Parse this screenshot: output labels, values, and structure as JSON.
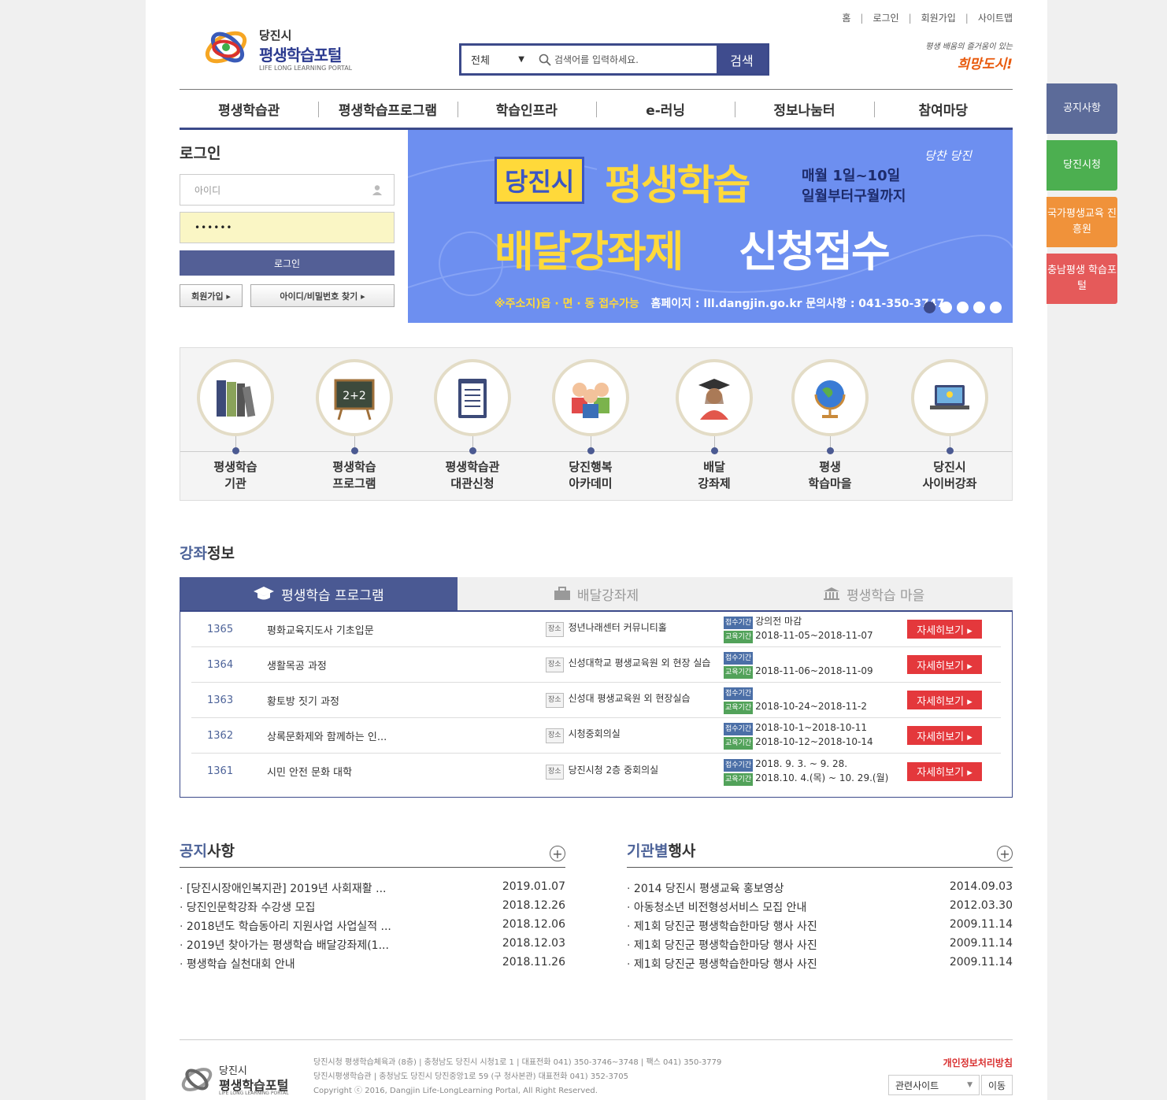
{
  "toplinks": [
    "홈",
    "로그인",
    "회원가입",
    "사이트맵"
  ],
  "logo": {
    "line1": "당진시",
    "line2": "평생학습포털",
    "line3": "LIFE LONG LEARNING PORTAL"
  },
  "search": {
    "select_value": "전체",
    "placeholder": "검색어를 입력하세요.",
    "button": "검색"
  },
  "slogan": {
    "line1": "평생 배움의 즐거움이 있는",
    "line2": "희망도시!"
  },
  "gnb": [
    "평생학습관",
    "평생학습프로그램",
    "학습인프라",
    "e-러닝",
    "정보나눔터",
    "참여마당"
  ],
  "login": {
    "title": "로그인",
    "id_placeholder": "아이디",
    "pw_value": "••••••",
    "login_button": "로그인",
    "join_button": "회원가입 ▸",
    "find_button": "아이디/비밀번호 찾기 ▸"
  },
  "banner": {
    "city": "당진시",
    "title": "평생학습",
    "date1": "매월 1일~10일",
    "date2": "일월부터구월까지",
    "sub1": "배달강좌제",
    "sub2": "신청접수",
    "tag": "당찬 당진",
    "info_a": "※주소지)읍 · 면 · 동 접수가능",
    "info_b": "홈페이지 : lll.dangjin.go.kr   문의사항 : 041-350-3747"
  },
  "quick": [
    {
      "icon": "books-icon",
      "line1": "평생학습",
      "line2": "기관"
    },
    {
      "icon": "blackboard-icon",
      "line1": "평생학습",
      "line2": "프로그램"
    },
    {
      "icon": "clipboard-icon",
      "line1": "평생학습관",
      "line2": "대관신청"
    },
    {
      "icon": "people-icon",
      "line1": "당진행복",
      "line2": "아카데미"
    },
    {
      "icon": "graduate-icon",
      "line1": "배달",
      "line2": "강좌제"
    },
    {
      "icon": "globe-icon",
      "line1": "평생",
      "line2": "학습마을"
    },
    {
      "icon": "laptop-icon",
      "line1": "당진시",
      "line2": "사이버강좌"
    }
  ],
  "courses": {
    "title_a": "강좌",
    "title_b": "정보",
    "tabs": [
      "평생학습 프로그램",
      "배달강좌제",
      "평생학습 마을"
    ],
    "place_tag": "장소",
    "apply_tag": "접수기간",
    "edu_tag": "교육기간",
    "more": "자세히보기 ▸",
    "rows": [
      {
        "no": "1365",
        "title": "평화교육지도사 기초입문",
        "place": "정년나래센터 커뮤니티홀",
        "apply": "강의전 마감",
        "edu": "2018-11-05~2018-11-07"
      },
      {
        "no": "1364",
        "title": "생활목공 과정",
        "place": "신성대학교 평생교육원 외 현장 실습",
        "apply": "",
        "edu": "2018-11-06~2018-11-09"
      },
      {
        "no": "1363",
        "title": "황토방 짓기 과정",
        "place": "신성대 평생교육원 외 현장실습",
        "apply": "",
        "edu": "2018-10-24~2018-11-2"
      },
      {
        "no": "1362",
        "title": "상록문화제와 함께하는 인...",
        "place": "시청중회의실",
        "apply": "2018-10-1~2018-10-11",
        "edu": "2018-10-12~2018-10-14"
      },
      {
        "no": "1361",
        "title": "시민 안전 문화 대학",
        "place": "당진시청 2층 중회의실",
        "apply": "2018. 9. 3. ~ 9. 28.",
        "edu": "2018.10. 4.(목) ~ 10. 29.(월)"
      }
    ]
  },
  "notice": {
    "title_a": "공지",
    "title_b": "사항",
    "items": [
      {
        "text": "[당진시장애인복지관] 2019년 사회재활 ...",
        "date": "2019.01.07"
      },
      {
        "text": "당진인문학강좌 수강생 모집",
        "date": "2018.12.26"
      },
      {
        "text": "2018년도 학습동아리 지원사업 사업실적 ...",
        "date": "2018.12.06"
      },
      {
        "text": "2019년 찾아가는 평생학습 배달강좌제(1...",
        "date": "2018.12.03"
      },
      {
        "text": "평생학습 실천대회 안내",
        "date": "2018.11.26"
      }
    ]
  },
  "events": {
    "title_a": "기관별",
    "title_b": "행사",
    "items": [
      {
        "text": "2014 당진시 평생교육 홍보영상",
        "date": "2014.09.03"
      },
      {
        "text": "아동청소년 비전형성서비스 모집 안내",
        "date": "2012.03.30"
      },
      {
        "text": "제1회 당진군 평생학습한마당 행사 사진",
        "date": "2009.11.14"
      },
      {
        "text": "제1회 당진군 평생학습한마당 행사 사진",
        "date": "2009.11.14"
      },
      {
        "text": "제1회 당진군 평생학습한마당 행사 사진",
        "date": "2009.11.14"
      }
    ]
  },
  "footer": {
    "logo1": "당진시",
    "logo2": "평생학습포털",
    "logo3": "LIFE LONG LEARNING PORTAL",
    "addr1": "당진시청 평생학습체육과 (8층) | 충청남도 당진시 시청1로 1 | 대표전화 041) 350-3746~3748 | 팩스 041) 350-3779",
    "addr2": "당진시평생학습관 | 충청남도 당진시 당진중앙1로 59 (구 청사본관) 대표전화 041) 352-3705",
    "addr3": "Copyright ⓒ 2016, Dangjin Life-LongLearning Portal,  All Right Reserved.",
    "privacy": "개인정보처리방침",
    "related": "관련사이트",
    "go": "이동"
  },
  "side": [
    {
      "label": "공지사항",
      "color": "#5c6b99"
    },
    {
      "label": "당진시청",
      "color": "#4caf50"
    },
    {
      "label": "국가평생교육 진흥원",
      "color": "#f0923a"
    },
    {
      "label": "충남평생 학습포털",
      "color": "#e55a5a"
    }
  ]
}
